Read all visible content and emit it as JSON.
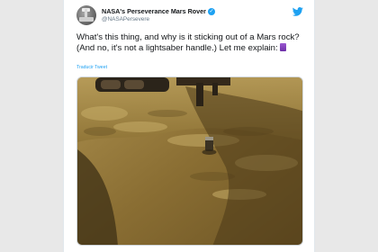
{
  "tweet": {
    "display_name": "NASA's Perseverance Mars Rover",
    "verified_icon": "verified-badge-icon",
    "handle": "@NASAPersevere",
    "text": "What's this thing, and why is it sticking out of a Mars rock? (And no, it's not a lightsaber handle.) Let me explain:",
    "emoji_icon": "purple-book-emoji",
    "translate_label": "Traducir Tweet",
    "media_description": "photo"
  },
  "colors": {
    "accent": "#1da1f2",
    "text": "#14171a",
    "secondary": "#657786"
  }
}
